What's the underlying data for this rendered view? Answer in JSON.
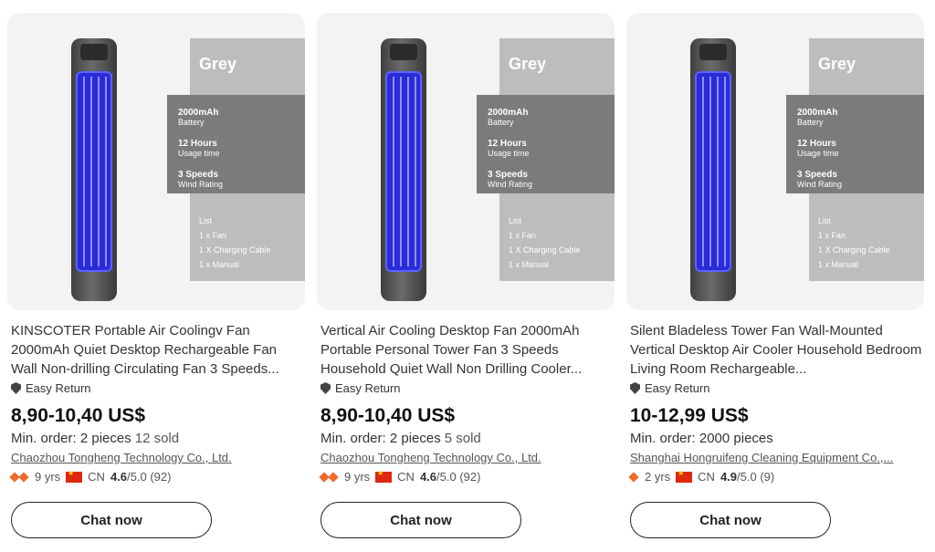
{
  "products": [
    {
      "title": "KINSCOTER Portable Air Coolingv Fan 2000mAh Quiet Desktop Rechargeable Fan Wall Non-drilling Circulating Fan 3 Speeds...",
      "easy_return": "Easy Return",
      "price": "8,90-10,40 US$",
      "min_order": "Min. order: 2 pieces",
      "sold": "12 sold",
      "supplier": "Chaozhou Tongheng Technology Co., Ltd.",
      "years": "9 yrs",
      "country": "CN",
      "rating": "4.6",
      "rating_suffix": "/5.0 (92)",
      "chat_label": "Chat now",
      "image": {
        "color": "Grey",
        "spec1": "2000mAh",
        "spec1_sub": "Battery",
        "spec2": "12 Hours",
        "spec2_sub": "Usage time",
        "spec3": "3 Speeds",
        "spec3_sub": "Wind Rating",
        "list_title": "List",
        "list1": "1 x Fan",
        "list2": "1 X Charging Cable",
        "list3": "1 x Manual"
      }
    },
    {
      "title": "Vertical Air Cooling Desktop Fan 2000mAh Portable Personal Tower Fan 3 Speeds Household Quiet Wall Non Drilling Cooler...",
      "easy_return": "Easy Return",
      "price": "8,90-10,40 US$",
      "min_order": "Min. order: 2 pieces",
      "sold": "5 sold",
      "supplier": "Chaozhou Tongheng Technology Co., Ltd.",
      "years": "9 yrs",
      "country": "CN",
      "rating": "4.6",
      "rating_suffix": "/5.0 (92)",
      "chat_label": "Chat now",
      "image": {
        "color": "Grey",
        "spec1": "2000mAh",
        "spec1_sub": "Battery",
        "spec2": "12 Hours",
        "spec2_sub": "Usage time",
        "spec3": "3 Speeds",
        "spec3_sub": "Wind Rating",
        "list_title": "List",
        "list1": "1 x Fan",
        "list2": "1 X Charging Cable",
        "list3": "1 x Manual"
      }
    },
    {
      "title": "Silent Bladeless Tower Fan Wall-Mounted Vertical Desktop Air Cooler Household Bedroom Living Room Rechargeable...",
      "easy_return": "Easy Return",
      "price": "10-12,99 US$",
      "min_order": "Min. order: 2000 pieces",
      "sold": "",
      "supplier": "Shanghai Hongruifeng Cleaning Equipment Co.,...",
      "years": "2 yrs",
      "country": "CN",
      "rating": "4.9",
      "rating_suffix": "/5.0 (9)",
      "chat_label": "Chat now",
      "image": {
        "color": "Grey",
        "spec1": "2000mAh",
        "spec1_sub": "Battery",
        "spec2": "12 Hours",
        "spec2_sub": "Usage time",
        "spec3": "3 Speeds",
        "spec3_sub": "Wind Rating",
        "list_title": "List",
        "list1": "1 x Fan",
        "list2": "1 X Charging Cable",
        "list3": "1 x Manual"
      }
    }
  ],
  "colors": {
    "fan_panel": "#2b2bd8",
    "badge": "#f06a2a",
    "flag": "#de2910"
  }
}
